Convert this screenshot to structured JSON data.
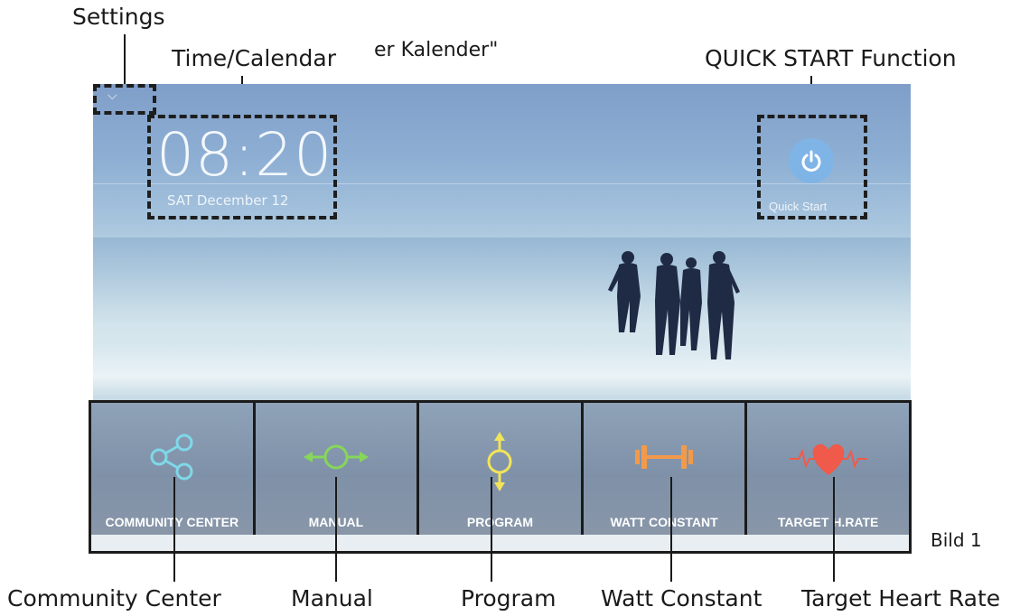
{
  "callouts": {
    "settings": "Settings",
    "time_calendar": "Time/Calendar",
    "fragment": "er Kalender\"",
    "quick_start_function": "QUICK START Function",
    "community_center": "Community Center",
    "manual": "Manual",
    "program": "Program",
    "watt_constant": "Watt Constant",
    "target_heart_rate": "Target Heart Rate"
  },
  "screen": {
    "time": "08:20",
    "date": "SAT December 12",
    "quick_start_label": "Quick Start",
    "settings_glyph": "⌵"
  },
  "tiles": [
    {
      "label": "COMMUNITY CENTER",
      "icon": "share-icon",
      "color": "#7fd8e8"
    },
    {
      "label": "MANUAL",
      "icon": "manual-icon",
      "color": "#86d65a"
    },
    {
      "label": "PROGRAM",
      "icon": "program-icon",
      "color": "#f2e45a"
    },
    {
      "label": "WATT CONSTANT",
      "icon": "dumbbell-icon",
      "color": "#f29a4a"
    },
    {
      "label": "TARGET H.RATE",
      "icon": "heart-rate-icon",
      "color": "#f05a4a"
    }
  ],
  "figure_label": "Bild 1"
}
